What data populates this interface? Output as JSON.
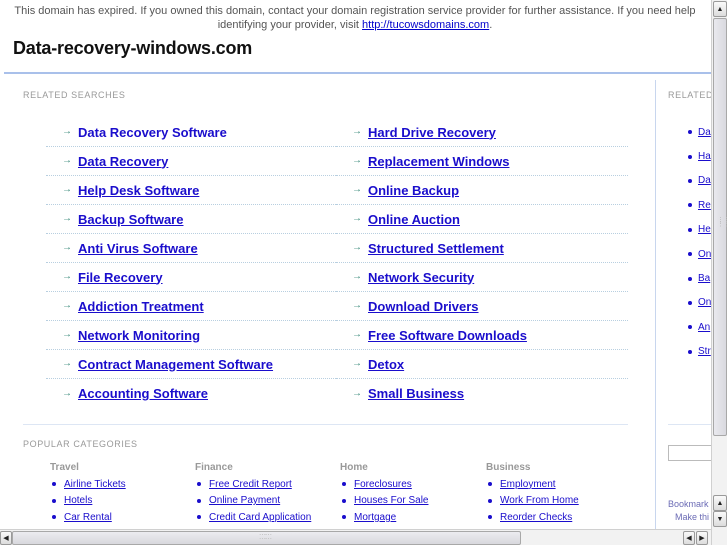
{
  "notice": {
    "text": "This domain has expired. If you owned this domain, contact your domain registration service provider for further assistance. If you need help identifying your provider, visit ",
    "link": "http://tucowsdomains.com",
    "suffix": "."
  },
  "site_title": "Data-recovery-windows.com",
  "related_searches": {
    "label": "RELATED SEARCHES",
    "left": [
      "Data Recovery Software",
      "Data Recovery",
      "Help Desk Software",
      "Backup Software",
      "Anti Virus Software",
      "File Recovery",
      "Addiction Treatment",
      "Network Monitoring",
      "Contract Management Software",
      "Accounting Software"
    ],
    "right": [
      "Hard Drive Recovery",
      "Replacement Windows",
      "Online Backup",
      "Online Auction",
      "Structured Settlement",
      "Network Security",
      "Download Drivers",
      "Free Software Downloads",
      "Detox",
      "Small Business"
    ]
  },
  "popular_categories": {
    "label": "POPULAR CATEGORIES",
    "columns": [
      {
        "heading": "Travel",
        "links": [
          "Airline Tickets",
          "Hotels",
          "Car Rental"
        ]
      },
      {
        "heading": "Finance",
        "links": [
          "Free Credit Report",
          "Online Payment",
          "Credit Card Application"
        ]
      },
      {
        "heading": "Home",
        "links": [
          "Foreclosures",
          "Houses For Sale",
          "Mortgage"
        ]
      },
      {
        "heading": "Business",
        "links": [
          "Employment",
          "Work From Home",
          "Reorder Checks"
        ]
      }
    ]
  },
  "sidebar": {
    "label": "RELATED",
    "items": [
      "Da",
      "Ha",
      "Da",
      "Re",
      "He",
      "On",
      "Ba",
      "On",
      "An",
      "Str"
    ],
    "footer1": "Bookmark",
    "footer2": "Make thi"
  },
  "icons": {
    "arrow": "→",
    "scroll_up": "▲",
    "scroll_down": "▼",
    "scroll_left": "◀",
    "scroll_right": "▶"
  }
}
